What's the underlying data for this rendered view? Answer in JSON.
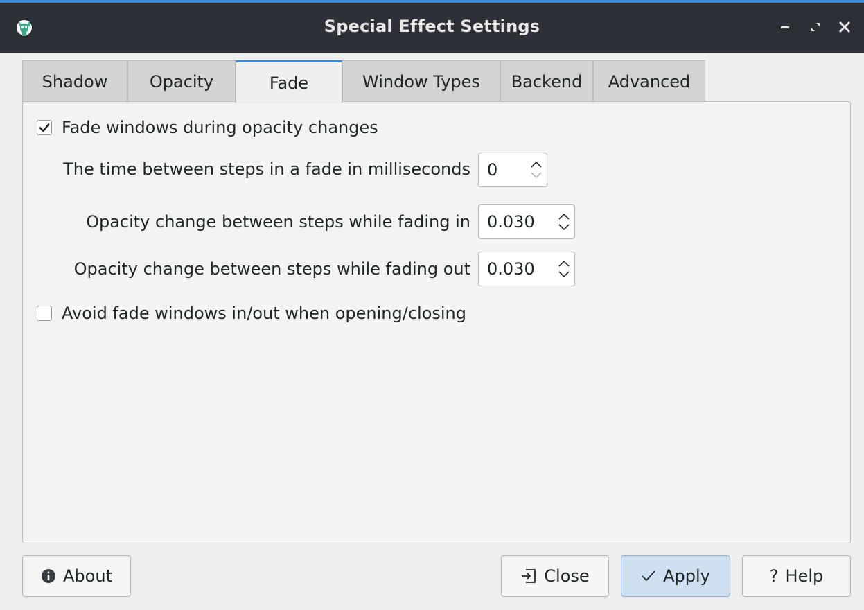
{
  "window": {
    "title": "Special Effect Settings",
    "accent_color": "#3b88d8",
    "titlebar_color": "#2d3036"
  },
  "tabs": [
    {
      "label": "Shadow",
      "active": false
    },
    {
      "label": "Opacity",
      "active": false
    },
    {
      "label": "Fade",
      "active": true
    },
    {
      "label": "Window Types",
      "active": false
    },
    {
      "label": "Backend",
      "active": false
    },
    {
      "label": "Advanced",
      "active": false
    }
  ],
  "fade": {
    "fade_windows": {
      "label": "Fade windows during opacity changes",
      "checked": true
    },
    "fade_delta": {
      "label": "The time between steps in a fade in milliseconds",
      "value": "0"
    },
    "fade_in_step": {
      "label": "Opacity change between steps while fading in",
      "value": "0.030"
    },
    "fade_out_step": {
      "label": "Opacity change between steps while fading out",
      "value": "0.030"
    },
    "no_fading_openclose": {
      "label": "Avoid fade windows in/out when opening/closing",
      "checked": false
    }
  },
  "buttons": {
    "about": "About",
    "close": "Close",
    "apply": "Apply",
    "help": "Help"
  },
  "icons": {
    "app": "compositor-app-icon",
    "about": "info-circle-icon",
    "close": "exit-icon",
    "apply": "checkmark-icon",
    "help": "question-mark-icon"
  }
}
